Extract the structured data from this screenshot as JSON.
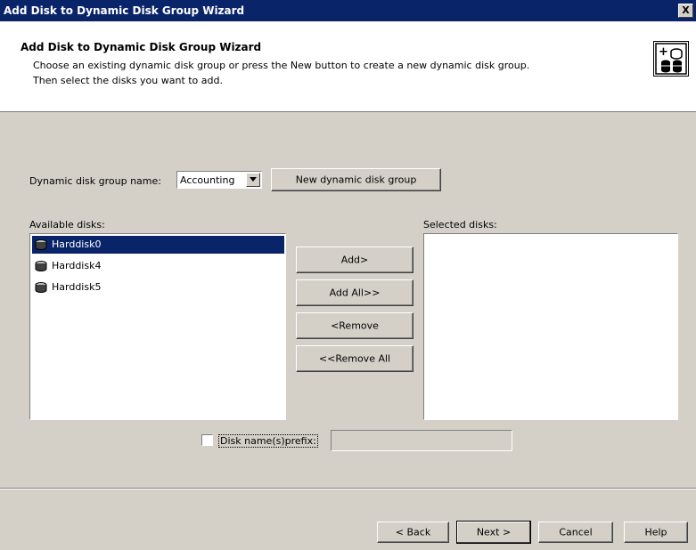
{
  "window": {
    "title": "Add Disk to Dynamic Disk Group Wizard",
    "close_label": "X"
  },
  "header": {
    "heading": "Add Disk to Dynamic Disk Group Wizard",
    "description_line1": "Choose an existing dynamic disk group or press the New button to create a new dynamic disk group.",
    "description_line2": "Then select the disks you want to add.",
    "logo_icon": "disk-group-add-icon"
  },
  "group": {
    "label": "Dynamic disk group name:",
    "selected": "Accounting",
    "new_button": "New dynamic disk group"
  },
  "available": {
    "label": "Available disks:",
    "items": [
      {
        "name": "Harddisk0",
        "selected": true,
        "icon": "disk-icon"
      },
      {
        "name": "Harddisk4",
        "selected": false,
        "icon": "disk-icon"
      },
      {
        "name": "Harddisk5",
        "selected": false,
        "icon": "disk-icon"
      }
    ]
  },
  "selected_disks": {
    "label": "Selected disks:",
    "items": []
  },
  "transfer": {
    "add": "Add>",
    "add_all": "Add All>>",
    "remove": "<Remove",
    "remove_all": "<<Remove All"
  },
  "prefix": {
    "label": "Disk name(s)prefix:",
    "checked": false,
    "value": ""
  },
  "footer": {
    "back": "< Back",
    "next": "Next >",
    "cancel": "Cancel",
    "help": "Help"
  }
}
